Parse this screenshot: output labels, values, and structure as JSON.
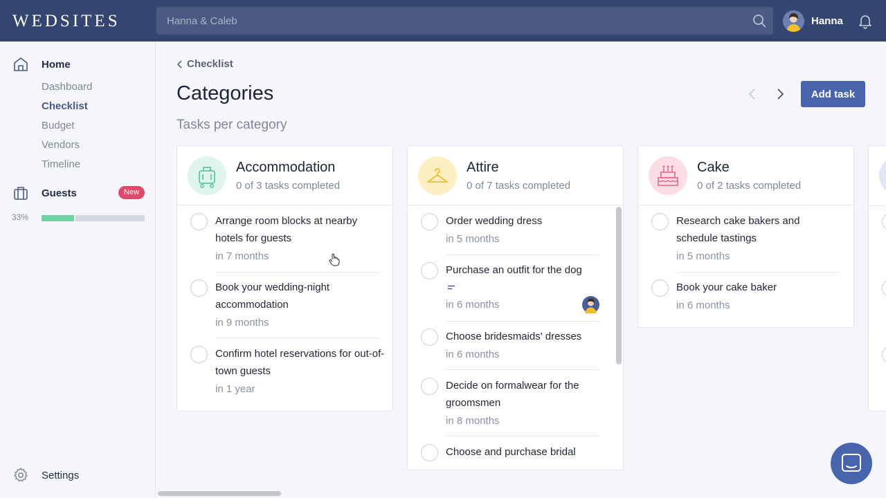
{
  "app": {
    "logo": "WEDSITES"
  },
  "header": {
    "search_placeholder": "Hanna & Caleb",
    "user_name": "Hanna"
  },
  "sidebar": {
    "home": "Home",
    "sub": [
      "Dashboard",
      "Checklist",
      "Budget",
      "Vendors",
      "Timeline"
    ],
    "guests": "Guests",
    "guests_badge": "New",
    "progress_label": "33%",
    "progress_value": 0.33,
    "settings": "Settings"
  },
  "main": {
    "back_label": "Checklist",
    "title": "Categories",
    "subtitle": "Tasks per category",
    "add_task": "Add task"
  },
  "categories": [
    {
      "title": "Accommodation",
      "count": "0 of 3 tasks completed",
      "icon": "luggage-cart-icon",
      "color": "#5fc9a0",
      "tasks": [
        {
          "title": "Arrange room blocks at nearby hotels for guests",
          "due": "in 7 months"
        },
        {
          "title": "Book your wedding-night accommodation",
          "due": "in 9 months"
        },
        {
          "title": "Confirm hotel reservations for out-of-town guests",
          "due": "in 1 year"
        }
      ]
    },
    {
      "title": "Attire",
      "count": "0 of 7 tasks completed",
      "icon": "hanger-icon",
      "color": "#f0c02a",
      "tasks": [
        {
          "title": "Order wedding dress",
          "due": "in 5 months"
        },
        {
          "title": "Purchase an outfit for the dog",
          "due": "in 6 months"
        },
        {
          "title": "Choose bridesmaids' dresses",
          "due": "in 6 months"
        },
        {
          "title": "Decide on formalwear for the groomsmen",
          "due": "in 8 months"
        },
        {
          "title": "Choose and purchase bridal",
          "due": ""
        }
      ]
    },
    {
      "title": "Cake",
      "count": "0 of 2 tasks completed",
      "icon": "cake-icon",
      "color": "#e2728c",
      "tasks": [
        {
          "title": "Research cake bakers and schedule tastings",
          "due": "in 5 months"
        },
        {
          "title": "Book your cake baker",
          "due": "in 6 months"
        }
      ]
    }
  ]
}
